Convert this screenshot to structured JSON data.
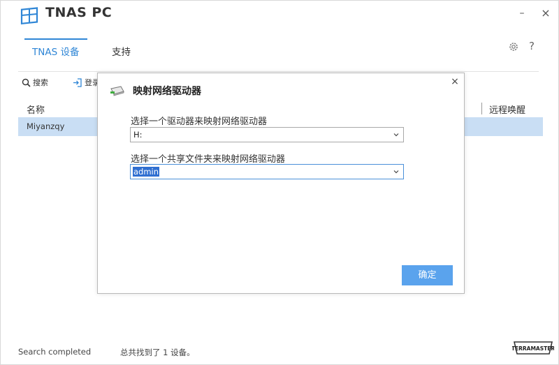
{
  "app": {
    "title": "TNAS PC",
    "min_glyph": "–",
    "close_glyph": "×",
    "logo_icon": "window-logo-icon"
  },
  "tabs": [
    {
      "label": "TNAS 设备",
      "active": true
    },
    {
      "label": "支持",
      "active": false
    }
  ],
  "header_actions": {
    "help": "?",
    "settings_icon": "gear-icon"
  },
  "toolbar": {
    "search_label": "搜索",
    "login_label": "登录"
  },
  "table": {
    "columns": [
      "名称",
      "远程唤醒"
    ],
    "rows": [
      {
        "name": "Miyanzqy",
        "selected": true
      }
    ]
  },
  "status": {
    "left": "Search completed",
    "right": "总共找到了 1  设备。"
  },
  "brand": {
    "name": "TERRAMASTER"
  },
  "dialog": {
    "title": "映射网络驱动器",
    "close_glyph": "×",
    "drive_label": "选择一个驱动器来映射网络驱动器",
    "drive_value": "H:",
    "folder_label": "选择一个共享文件夹来映射网络驱动器",
    "folder_value": "admin",
    "ok_label": "确定"
  },
  "colors": {
    "accent": "#2f86d6",
    "selected_row": "#c9def4",
    "ok_button": "#5aa3ed"
  }
}
